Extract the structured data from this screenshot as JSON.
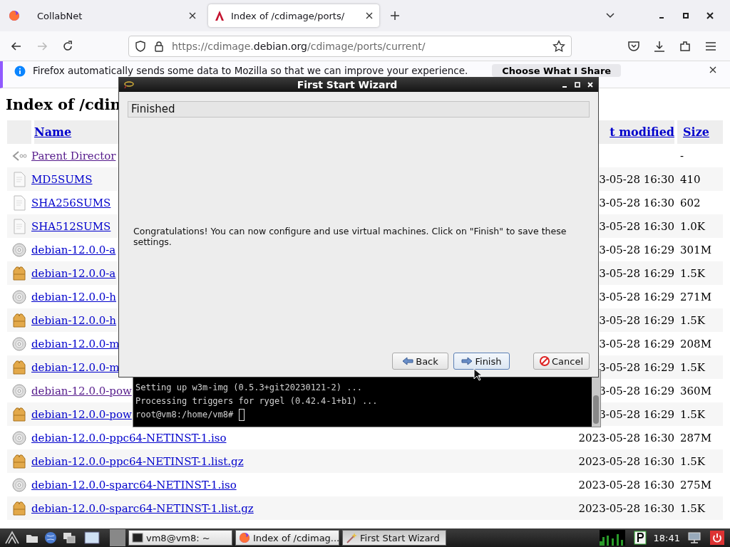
{
  "browser": {
    "tabs": [
      {
        "title": "CollabNet",
        "selected": false,
        "kind": "firefox"
      },
      {
        "title": "Index of /cdimage/ports/",
        "selected": true,
        "kind": "debian"
      }
    ],
    "nav": {
      "back_disabled": false,
      "forward_disabled": true
    },
    "url_parts": [
      {
        "text": "https://cdimage.",
        "emphasis": false
      },
      {
        "text": "debian.org",
        "emphasis": true
      },
      {
        "text": "/cdimage/ports/current/",
        "emphasis": false
      }
    ],
    "notification": {
      "text": "Firefox automatically sends some data to Mozilla so that we can improve your experience.",
      "button": "Choose What I Share"
    },
    "page": {
      "heading": "Index of /cdin",
      "columns": [
        "Name",
        "t modified",
        "Size"
      ],
      "rows": [
        {
          "kind": "parent",
          "name": "Parent Director",
          "visited": true,
          "modified": "",
          "size": "-"
        },
        {
          "kind": "text",
          "name": "MD5SUMS",
          "visited": false,
          "modified": "3-05-28 16:30",
          "size": "410"
        },
        {
          "kind": "text",
          "name": "SHA256SUMS",
          "visited": false,
          "modified": "3-05-28 16:30",
          "size": "602"
        },
        {
          "kind": "text",
          "name": "SHA512SUMS",
          "visited": false,
          "modified": "3-05-28 16:30",
          "size": "1.0K"
        },
        {
          "kind": "disc",
          "name": "debian-12.0.0-a",
          "visited": false,
          "modified": "3-05-28 16:29",
          "size": "301M"
        },
        {
          "kind": "archive",
          "name": "debian-12.0.0-a",
          "visited": false,
          "modified": "3-05-28 16:29",
          "size": "1.5K"
        },
        {
          "kind": "disc",
          "name": "debian-12.0.0-h",
          "visited": false,
          "modified": "3-05-28 16:29",
          "size": "271M"
        },
        {
          "kind": "archive",
          "name": "debian-12.0.0-h",
          "visited": false,
          "modified": "3-05-28 16:29",
          "size": "1.5K"
        },
        {
          "kind": "disc",
          "name": "debian-12.0.0-m",
          "visited": false,
          "modified": "3-05-28 16:29",
          "size": "208M"
        },
        {
          "kind": "archive",
          "name": "debian-12.0.0-m",
          "visited": false,
          "modified": "3-05-28 16:29",
          "size": "1.5K"
        },
        {
          "kind": "disc",
          "name": "debian-12.0.0-pow",
          "visited": true,
          "modified": "3-05-28 16:29",
          "size": "360M"
        },
        {
          "kind": "archive",
          "name": "debian-12.0.0-pow",
          "visited": false,
          "modified": "3-05-28 16:29",
          "size": "1.5K"
        },
        {
          "kind": "disc",
          "name": "debian-12.0.0-ppc64-NETINST-1.iso",
          "visited": false,
          "modified": "2023-05-28 16:30",
          "size": "287M"
        },
        {
          "kind": "archive",
          "name": "debian-12.0.0-ppc64-NETINST-1.list.gz",
          "visited": false,
          "modified": "2023-05-28 16:30",
          "size": "1.5K"
        },
        {
          "kind": "disc",
          "name": "debian-12.0.0-sparc64-NETINST-1.iso",
          "visited": false,
          "modified": "2023-05-28 16:30",
          "size": "275M"
        },
        {
          "kind": "archive",
          "name": "debian-12.0.0-sparc64-NETINST-1.list.gz",
          "visited": false,
          "modified": "2023-05-28 16:30",
          "size": "1.5K"
        }
      ]
    }
  },
  "terminal": {
    "lines": [
      "Setting up w3m-img (0.5.3+git20230121-2) ...",
      "Processing triggers for rygel (0.42.4-1+b1) ...",
      "root@vm8:/home/vm8# "
    ]
  },
  "wizard": {
    "title": "First Start Wizard",
    "page_title": "Finished",
    "message": "Congratulations! You can now configure and use virtual machines. Click on \"Finish\" to save these settings.",
    "buttons": [
      {
        "kind": "back",
        "label": "Back",
        "focused": false
      },
      {
        "kind": "finish",
        "label": "Finish",
        "focused": true
      },
      {
        "kind": "cancel",
        "label": "Cancel",
        "focused": false
      }
    ]
  },
  "taskbar": {
    "tasks": [
      {
        "kind": "terminal",
        "label": "vm8@vm8: ~",
        "selected": false
      },
      {
        "kind": "firefox",
        "label": "Index of /cdimag...",
        "selected": false
      },
      {
        "kind": "wizard",
        "label": "First Start Wizard",
        "selected": true
      }
    ],
    "clock": "18:41"
  }
}
